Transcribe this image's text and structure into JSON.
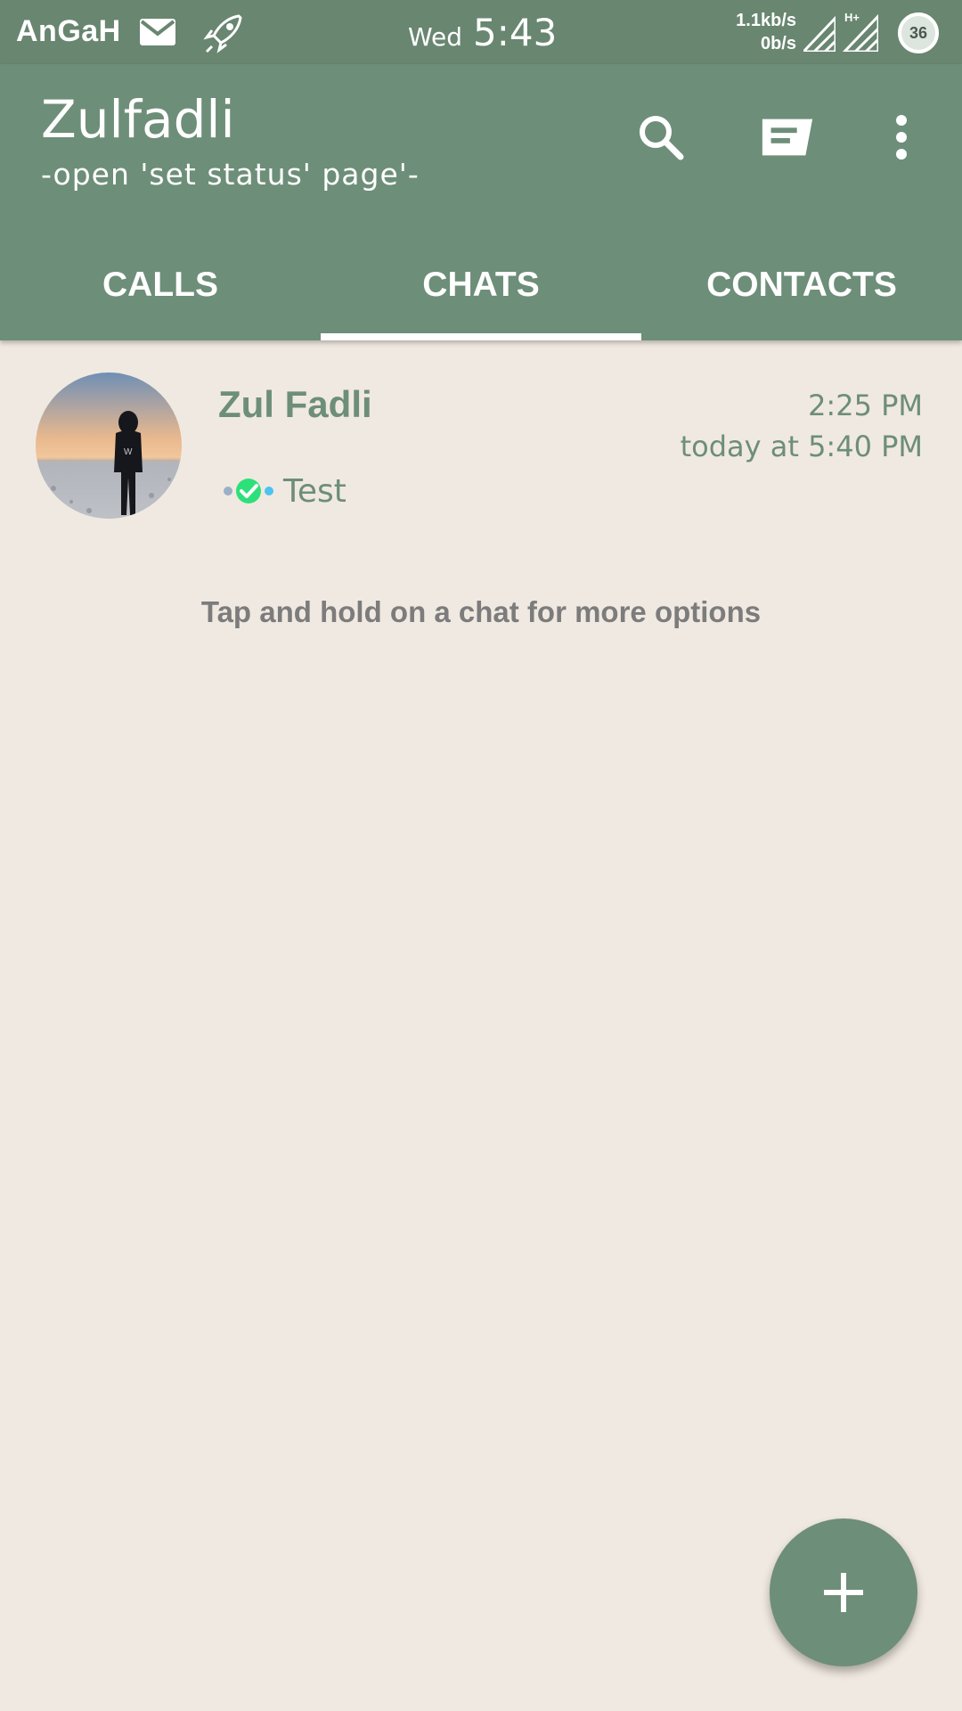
{
  "status_bar": {
    "carrier": "AnGaH",
    "day": "Wed",
    "time": "5:43",
    "net_up": "1.1kb/s",
    "net_down": "0b/s",
    "network_type": "H+",
    "battery": "36",
    "icons": [
      "mail-icon",
      "rocket-icon",
      "signal-icon",
      "battery-icon"
    ]
  },
  "app_bar": {
    "title": "Zulfadli",
    "subtitle": "-open 'set status' page'-",
    "icons": [
      "search-icon",
      "compose-icon",
      "more-vert-icon"
    ]
  },
  "tabs": [
    {
      "label": "CALLS",
      "active": false
    },
    {
      "label": "CHATS",
      "active": true
    },
    {
      "label": "CONTACTS",
      "active": false
    }
  ],
  "chats": [
    {
      "name": "Zul Fadli",
      "time": "2:25 PM",
      "last_seen": "today at 5:40 PM",
      "preview": "Test",
      "status_icon": "read-tick-icon"
    }
  ],
  "hint": "Tap and hold on a chat for more options",
  "fab": {
    "icon": "plus-icon"
  },
  "colors": {
    "primary": "#6d8e78",
    "status_bar": "#688670",
    "background": "#f0e9e1",
    "hint_text": "#7c7c7c",
    "tick_green": "#2ee07a"
  }
}
